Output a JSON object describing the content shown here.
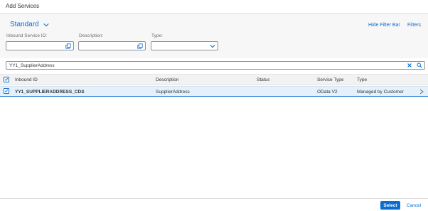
{
  "dialog": {
    "title": "Add Services"
  },
  "filterbar": {
    "variant": "Standard",
    "hide_filter_bar": "Hide Filter Bar",
    "filters": "Filters",
    "fields": [
      {
        "label": "Inbound Service ID:",
        "value": ""
      },
      {
        "label": "Description:",
        "value": ""
      },
      {
        "label": "Type:",
        "value": ""
      }
    ]
  },
  "search": {
    "value": "YY1_SupplierAddress"
  },
  "table": {
    "columns": [
      "Inbound ID",
      "Description",
      "Status",
      "Service Type",
      "Type"
    ],
    "rows": [
      {
        "selected": true,
        "inbound_id": "YY1_SUPPLIERADDRESS_CDS",
        "description": "SupplierAddress",
        "status": "",
        "service_type": "OData V2",
        "type": "Managed by Customer"
      }
    ]
  },
  "footer": {
    "select": "Select",
    "cancel": "Cancel"
  },
  "colors": {
    "accent": "#0a6ed1",
    "selected_row": "#e5f0fa",
    "filterbar_bg": "#f7f7f7"
  }
}
